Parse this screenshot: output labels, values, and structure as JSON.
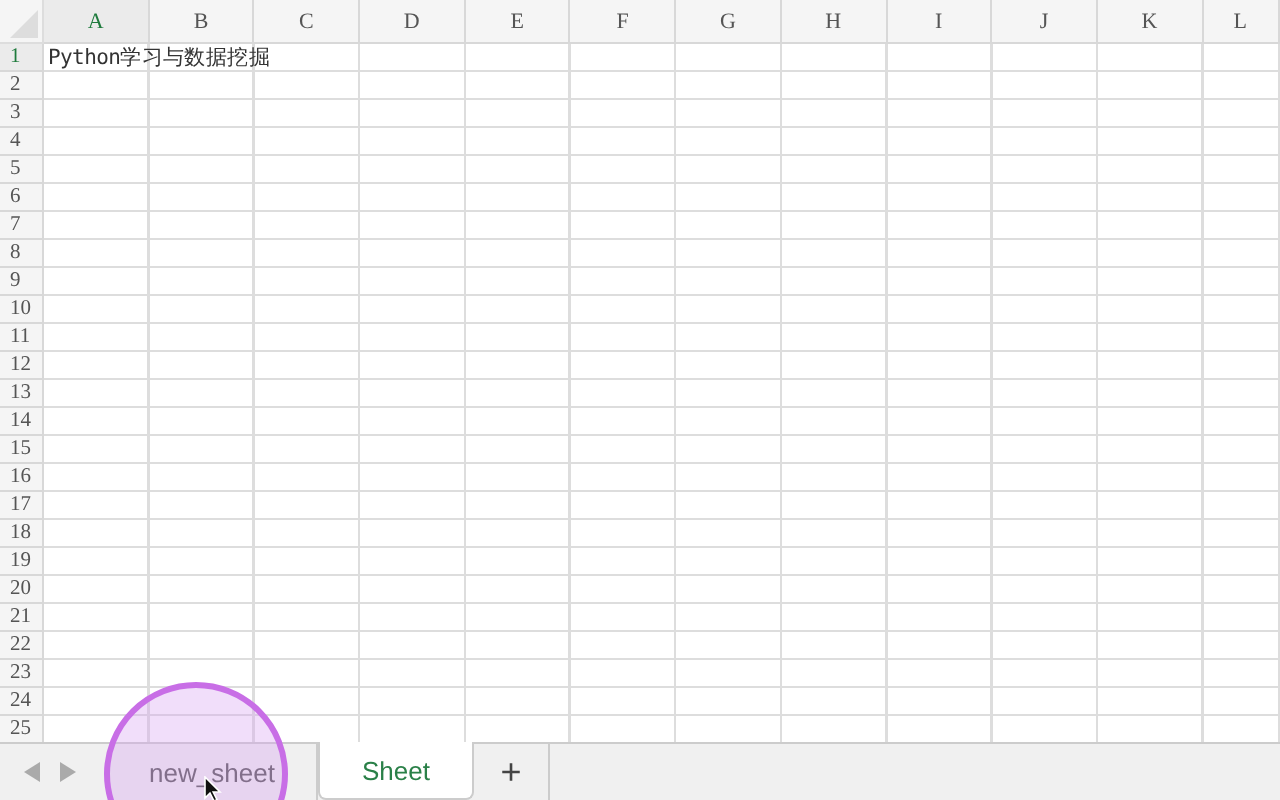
{
  "columns": [
    {
      "label": "A",
      "selected": true
    },
    {
      "label": "B",
      "selected": false
    },
    {
      "label": "C",
      "selected": false
    },
    {
      "label": "D",
      "selected": false
    },
    {
      "label": "E",
      "selected": false
    },
    {
      "label": "F",
      "selected": false
    },
    {
      "label": "G",
      "selected": false
    },
    {
      "label": "H",
      "selected": false
    },
    {
      "label": "I",
      "selected": false
    },
    {
      "label": "J",
      "selected": false
    },
    {
      "label": "K",
      "selected": false
    },
    {
      "label": "L",
      "selected": false
    }
  ],
  "rows": [
    {
      "number": "1",
      "selected": true,
      "cells": [
        "Python学习与数据挖掘"
      ]
    },
    {
      "number": "2",
      "selected": false,
      "cells": []
    },
    {
      "number": "3",
      "selected": false,
      "cells": []
    },
    {
      "number": "4",
      "selected": false,
      "cells": []
    },
    {
      "number": "5",
      "selected": false,
      "cells": []
    },
    {
      "number": "6",
      "selected": false,
      "cells": []
    },
    {
      "number": "7",
      "selected": false,
      "cells": []
    },
    {
      "number": "8",
      "selected": false,
      "cells": []
    },
    {
      "number": "9",
      "selected": false,
      "cells": []
    },
    {
      "number": "10",
      "selected": false,
      "cells": []
    },
    {
      "number": "11",
      "selected": false,
      "cells": []
    },
    {
      "number": "12",
      "selected": false,
      "cells": []
    },
    {
      "number": "13",
      "selected": false,
      "cells": []
    },
    {
      "number": "14",
      "selected": false,
      "cells": []
    },
    {
      "number": "15",
      "selected": false,
      "cells": []
    },
    {
      "number": "16",
      "selected": false,
      "cells": []
    },
    {
      "number": "17",
      "selected": false,
      "cells": []
    },
    {
      "number": "18",
      "selected": false,
      "cells": []
    },
    {
      "number": "19",
      "selected": false,
      "cells": []
    },
    {
      "number": "20",
      "selected": false,
      "cells": []
    },
    {
      "number": "21",
      "selected": false,
      "cells": []
    },
    {
      "number": "22",
      "selected": false,
      "cells": []
    },
    {
      "number": "23",
      "selected": false,
      "cells": []
    },
    {
      "number": "24",
      "selected": false,
      "cells": []
    },
    {
      "number": "25",
      "selected": false,
      "cells": []
    }
  ],
  "sheet_tabs": [
    {
      "label": "new_sheet",
      "selected": false
    },
    {
      "label": "Sheet",
      "selected": true
    }
  ],
  "add_sheet": {
    "label": "+"
  }
}
